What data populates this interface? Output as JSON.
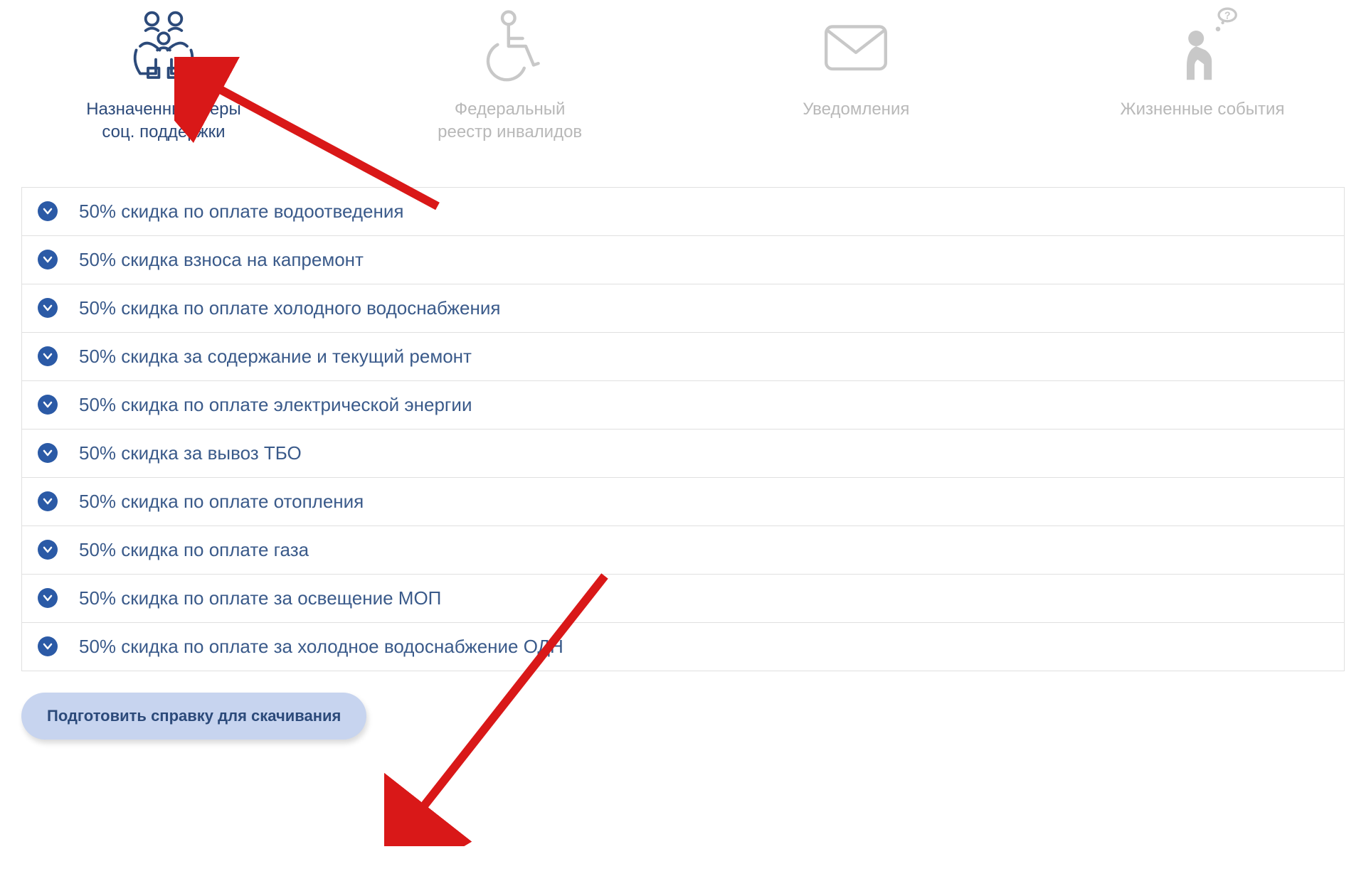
{
  "tabs": [
    {
      "id": "social-support",
      "label": "Назначенные меры\nсоц. поддержки",
      "active": true
    },
    {
      "id": "disabled-registry",
      "label": "Федеральный\nреестр инвалидов",
      "active": false
    },
    {
      "id": "notifications",
      "label": "Уведомления",
      "active": false
    },
    {
      "id": "life-events",
      "label": "Жизненные события",
      "active": false
    }
  ],
  "items": [
    {
      "label": "50% скидка по оплате водоотведения"
    },
    {
      "label": "50% скидка взноса на капремонт"
    },
    {
      "label": "50% скидка по оплате холодного водоснабжения"
    },
    {
      "label": "50% скидка за содержание и текущий ремонт"
    },
    {
      "label": "50% скидка по оплате электрической энергии"
    },
    {
      "label": "50% скидка за вывоз ТБО"
    },
    {
      "label": "50% скидка по оплате отопления"
    },
    {
      "label": "50% скидка по оплате газа"
    },
    {
      "label": "50% скидка по оплате за освещение МОП"
    },
    {
      "label": "50% скидка по оплате за холодное водоснабжение ОДН"
    }
  ],
  "button": {
    "label": "Подготовить справку для скачивания"
  },
  "colors": {
    "accent": "#2b5aa6",
    "text_active": "#2c4a7a",
    "text_inactive": "#b8b8b8",
    "arrow": "#d91818"
  }
}
